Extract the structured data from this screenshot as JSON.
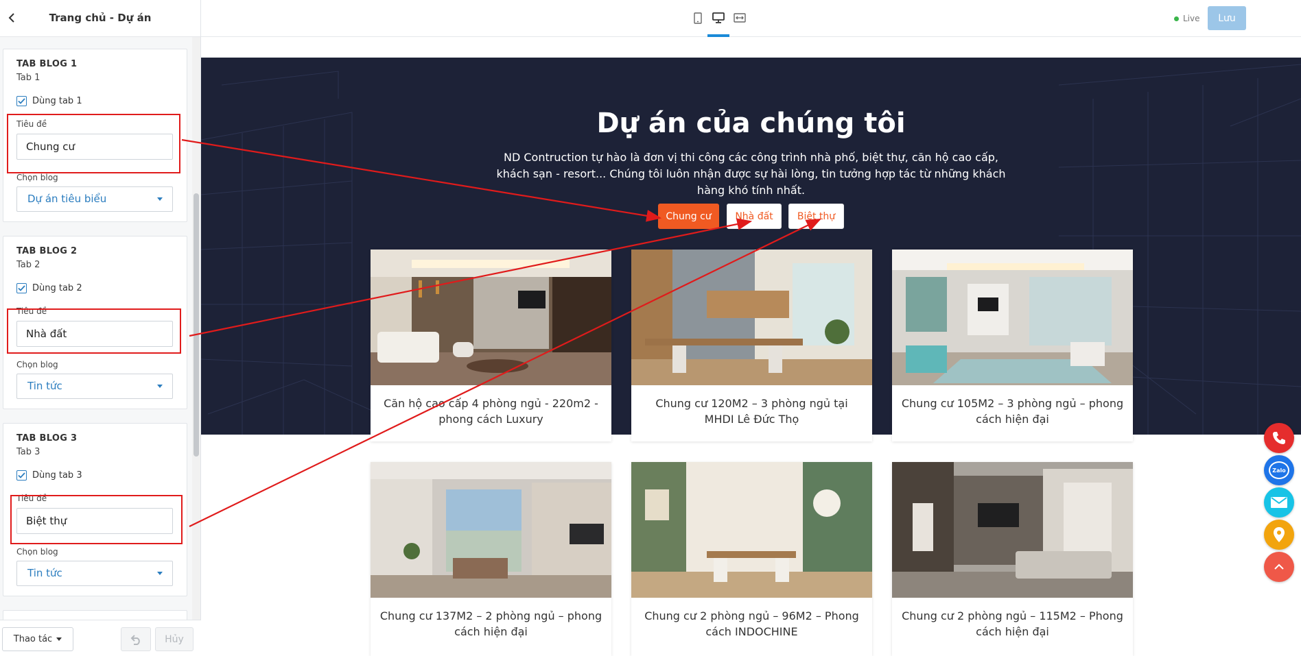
{
  "sidebar": {
    "title": "Trang chủ - Dự án",
    "panels": [
      {
        "heading": "TAB BLOG 1",
        "sub": "Tab 1",
        "use_label": "Dùng tab 1",
        "title_label": "Tiêu đề",
        "title_value": "Chung cư",
        "blog_label": "Chọn blog",
        "blog_value": "Dự án tiêu biểu"
      },
      {
        "heading": "TAB BLOG 2",
        "sub": "Tab 2",
        "use_label": "Dùng tab 2",
        "title_label": "Tiêu đề",
        "title_value": "Nhà đất",
        "blog_label": "Chọn blog",
        "blog_value": "Tin tức"
      },
      {
        "heading": "TAB BLOG 3",
        "sub": "Tab 3",
        "use_label": "Dùng tab 3",
        "title_label": "Tiêu đề",
        "title_value": "Biệt thự",
        "blog_label": "Chọn blog",
        "blog_value": "Tin tức"
      }
    ],
    "footer": {
      "actions_label": "Thao tác",
      "cancel_label": "Hủy"
    }
  },
  "topbar": {
    "live_label": "Live",
    "save_label": "Lưu"
  },
  "preview": {
    "title": "Dự án của chúng tôi",
    "description": "ND Contruction tự hào là đơn vị thi công các công trình nhà phố, biệt thự, căn hộ cao cấp, khách sạn - resort... Chúng tôi luôn nhận được sự hài lòng, tin tưởng hợp tác từ những khách hàng khó tính nhất.",
    "tabs": [
      "Chung cư",
      "Nhà đất",
      "Biệt thự"
    ],
    "cards": [
      {
        "title": "Căn hộ cao cấp 4 phòng ngủ - 220m2 - phong cách Luxury"
      },
      {
        "title": "Chung cư 120M2 – 3 phòng ngủ tại MHDI Lê Đức Thọ"
      },
      {
        "title": "Chung cư 105M2 – 3 phòng ngủ – phong cách hiện đại"
      },
      {
        "title": "Chung cư 137M2 – 2 phòng ngủ – phong cách hiện đại"
      },
      {
        "title": "Chung cư 2 phòng ngủ – 96M2 – Phong cách INDOCHINE"
      },
      {
        "title": "Chung cư 2 phòng ngủ – 115M2 – Phong cách hiện đại"
      }
    ]
  },
  "floating": {
    "zalo_label": "Zalo"
  },
  "colors": {
    "accent": "#f05a22",
    "hero_bg": "#1d2237",
    "link_blue": "#2b7dbf",
    "annotation_red": "#e01b1b"
  }
}
